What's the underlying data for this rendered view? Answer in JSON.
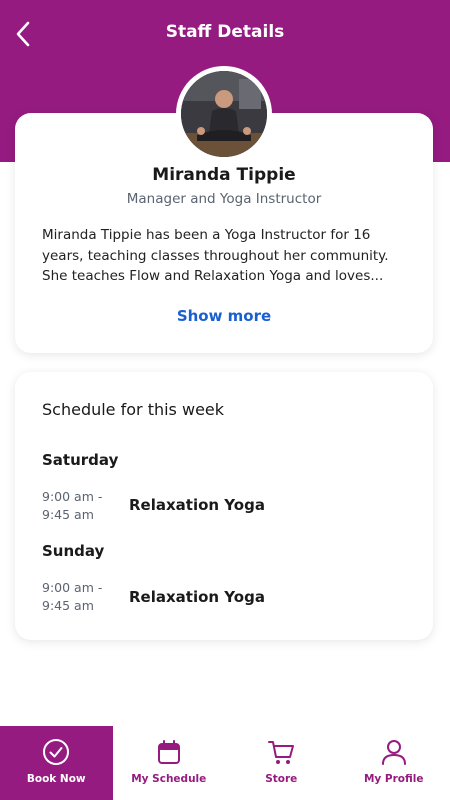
{
  "header": {
    "title": "Staff Details",
    "back_icon": "chevron-left-icon"
  },
  "colors": {
    "brand": "#951b81",
    "link": "#1a5fd0",
    "muted": "#5a6470"
  },
  "staff": {
    "name": "Miranda Tippie",
    "role": "Manager and Yoga Instructor",
    "bio": "Miranda Tippie has been a Yoga Instructor for 16 years, teaching classes throughout her community. She teaches Flow and Relaxation Yoga and loves...",
    "show_more_label": "Show more"
  },
  "schedule": {
    "title": "Schedule for this week",
    "days": [
      {
        "day": "Saturday",
        "sessions": [
          {
            "time_start": "9:00 am -",
            "time_end": "9:45 am",
            "class": "Relaxation Yoga"
          }
        ]
      },
      {
        "day": "Sunday",
        "sessions": [
          {
            "time_start": "9:00 am -",
            "time_end": "9:45 am",
            "class": "Relaxation Yoga"
          }
        ]
      }
    ]
  },
  "tabbar": {
    "items": [
      {
        "label": "Book Now",
        "icon": "check-circle-icon",
        "active": true
      },
      {
        "label": "My Schedule",
        "icon": "calendar-icon",
        "active": false
      },
      {
        "label": "Store",
        "icon": "cart-icon",
        "active": false
      },
      {
        "label": "My Profile",
        "icon": "user-icon",
        "active": false
      }
    ]
  }
}
